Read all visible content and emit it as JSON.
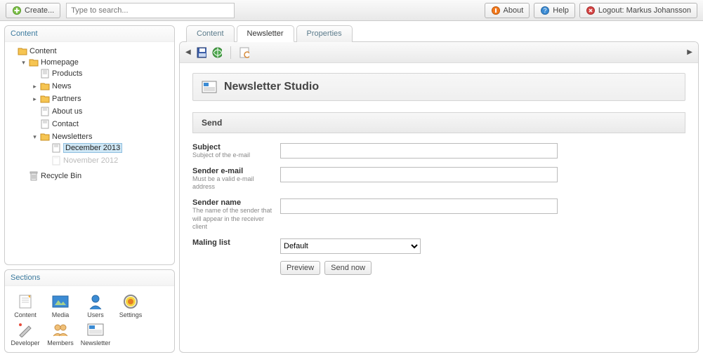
{
  "toolbar": {
    "create_label": "Create...",
    "search_placeholder": "Type to search...",
    "about_label": "About",
    "help_label": "Help",
    "logout_label": "Logout: Markus Johansson"
  },
  "tree_panel_title": "Content",
  "tree": {
    "root": "Content",
    "homepage": "Homepage",
    "products": "Products",
    "news": "News",
    "partners": "Partners",
    "about": "About us",
    "contact": "Contact",
    "newsletters": "Newsletters",
    "dec2013": "December 2013",
    "nov2012": "November 2012",
    "recycle": "Recycle Bin"
  },
  "sections_panel_title": "Sections",
  "sections": {
    "content": "Content",
    "media": "Media",
    "users": "Users",
    "settings": "Settings",
    "developer": "Developer",
    "members": "Members",
    "newsletter": "Newsletter"
  },
  "tabs": {
    "content": "Content",
    "newsletter": "Newsletter",
    "properties": "Properties"
  },
  "studio": {
    "title": "Newsletter Studio",
    "section_send": "Send",
    "subject_label": "Subject",
    "subject_hint": "Subject of the e-mail",
    "sender_email_label": "Sender e-mail",
    "sender_email_hint": "Must be a valid e-mail address",
    "sender_name_label": "Sender name",
    "sender_name_hint": "The name of the sender that will appear in the receiver client",
    "mailing_list_label": "Maling list",
    "mailing_list_options": [
      "Default"
    ],
    "preview_btn": "Preview",
    "send_now_btn": "Send now"
  }
}
